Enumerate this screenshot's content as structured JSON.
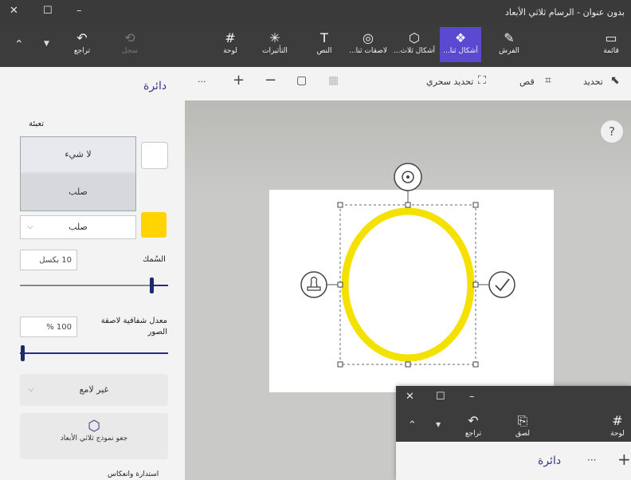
{
  "window": {
    "title": "بدون عنوان - الرسام ثلاثي الأبعاد",
    "close_glyph": "✕",
    "maximize_glyph": "☐",
    "minimize_glyph": "–"
  },
  "ribbon": {
    "collapse_glyph": "⌃",
    "undo_label": "تراجع",
    "history_label": "سجل",
    "tools": [
      {
        "label": "لوحة",
        "icon": "#"
      },
      {
        "label": "التأثيرات",
        "icon": "✳"
      },
      {
        "label": "النص",
        "icon": "T"
      },
      {
        "label": "لاصقات ثنا...",
        "icon": "◎"
      },
      {
        "label": "أشكال ثلاث...",
        "icon": "⬡"
      },
      {
        "label": "أشكال ثنا...",
        "icon": "❖"
      },
      {
        "label": "الفرش",
        "icon": "✎"
      },
      {
        "label": "قائمة",
        "icon": "▭"
      }
    ],
    "accent_color": "#5a4ad1"
  },
  "toolbar": {
    "select": "تحديد",
    "crop": "قص",
    "magic_select": "تحديد سحري",
    "more": "···",
    "zoom_in": "+",
    "zoom_out": "−"
  },
  "panel": {
    "title": "دائرة",
    "fill_label": "تعبئة",
    "fill_options": [
      "لا شيء",
      "صلب"
    ],
    "line_type": "صلب",
    "line_color": "#ffd400",
    "thickness_label": "السُمك",
    "thickness_value": "10 بكسل",
    "opacity_label": "معدل شفافية لاصقة الصور",
    "opacity_value": "100 %",
    "finish_label": "غير لامع",
    "make3d_label": "جعو نموذج ثلاثي الأبعاد",
    "footer_label": "استدارة وانعكاس"
  },
  "canvas": {
    "help": "?",
    "shape_stroke_color": "#f5e100",
    "stamp_icon": "stamp",
    "confirm_icon": "check"
  },
  "overlay_window": {
    "undo_label": "تراجع",
    "paste_label": "لصق",
    "canvas_label": "لوحة",
    "panel_title": "دائرة",
    "more": "···",
    "plus": "+"
  }
}
